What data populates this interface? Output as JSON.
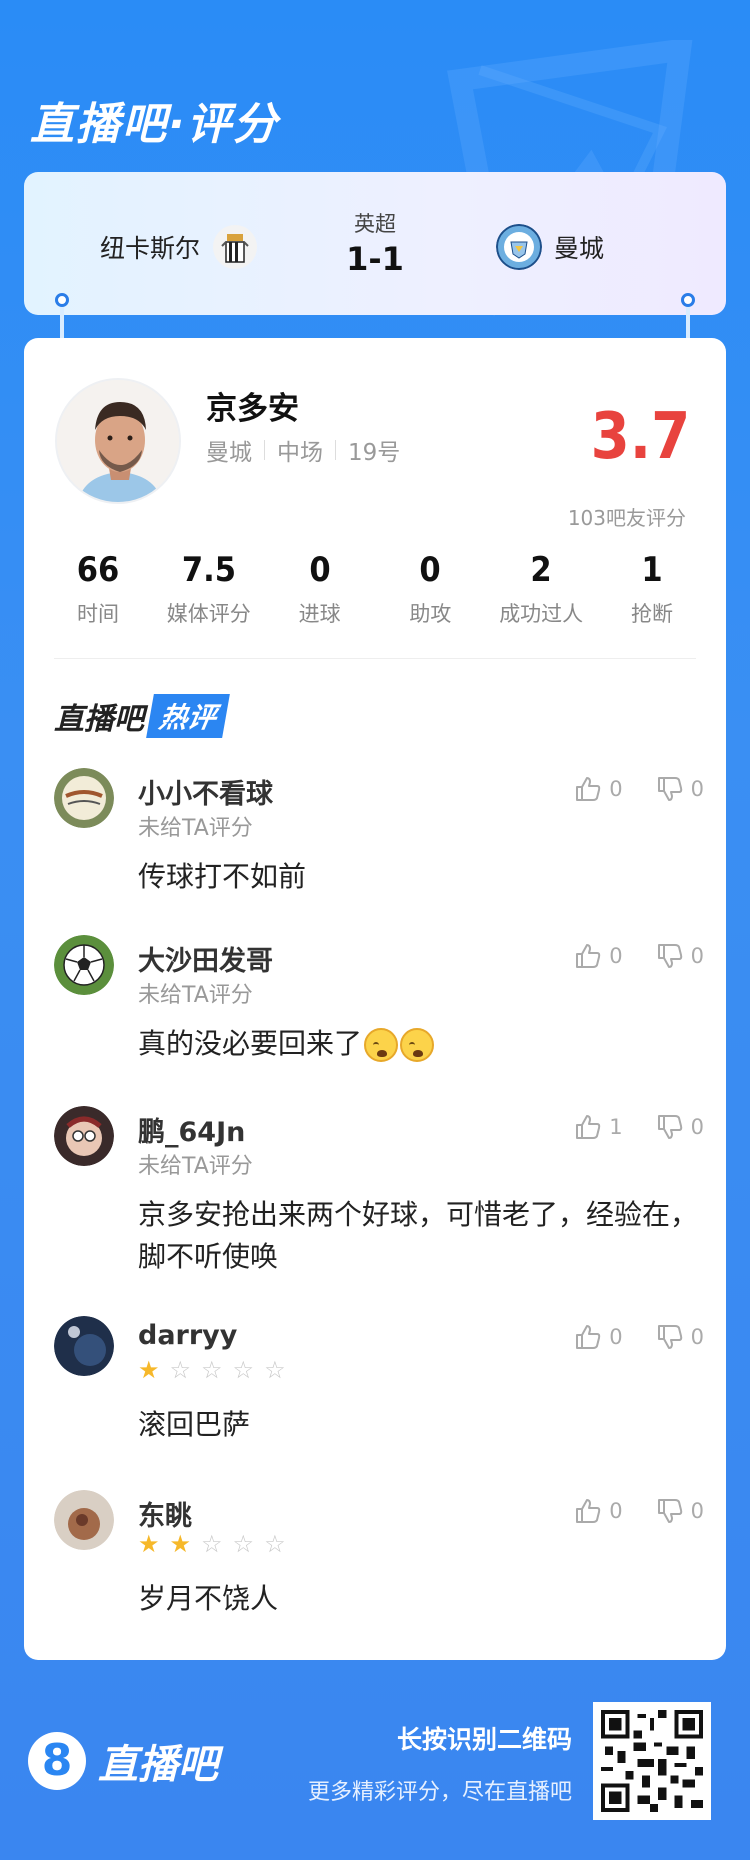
{
  "header": {
    "title": "直播吧·评分"
  },
  "match": {
    "league": "英超",
    "score": "1-1",
    "home_team": "纽卡斯尔",
    "away_team": "曼城",
    "home_crest_icon": "newcastle-crest-icon",
    "away_crest_icon": "man-city-crest-icon"
  },
  "player": {
    "name": "京多安",
    "club": "曼城",
    "position": "中场",
    "number": "19号",
    "rating": "3.7",
    "rating_count": "103吧友评分"
  },
  "stats": [
    {
      "value": "66",
      "label": "时间"
    },
    {
      "value": "7.5",
      "label": "媒体评分"
    },
    {
      "value": "0",
      "label": "进球"
    },
    {
      "value": "0",
      "label": "助攻"
    },
    {
      "value": "2",
      "label": "成功过人"
    },
    {
      "value": "1",
      "label": "抢断"
    }
  ],
  "hot": {
    "part1": "直播吧",
    "part2": "热评"
  },
  "comments": [
    {
      "user": "小小不看球",
      "sub": "未给TA评分",
      "text": "传球打不如前",
      "likes": "0",
      "dislikes": "0"
    },
    {
      "user": "大沙田发哥",
      "sub": "未给TA评分",
      "text": "真的没必要回来了",
      "emoji": "crying-emoji",
      "likes": "0",
      "dislikes": "0"
    },
    {
      "user": "鹏_64Jn",
      "sub": "未给TA评分",
      "text": "京多安抢出来两个好球，可惜老了，经验在，脚不听使唤",
      "likes": "1",
      "dislikes": "0"
    },
    {
      "user": "darryy",
      "stars": 1,
      "text": "滚回巴萨",
      "likes": "0",
      "dislikes": "0"
    },
    {
      "user": "东眺",
      "stars": 2,
      "text": "岁月不饶人",
      "likes": "0",
      "dislikes": "0"
    }
  ],
  "footer": {
    "logo_glyph": "8",
    "brand": "直播吧",
    "cta_title": "长按识别二维码",
    "cta_sub": "更多精彩评分，尽在直播吧",
    "qr_icon": "qr-code-icon"
  },
  "colors": {
    "accent": "#2b86f2",
    "rating": "#e8433e",
    "star": "#f6b82a"
  }
}
